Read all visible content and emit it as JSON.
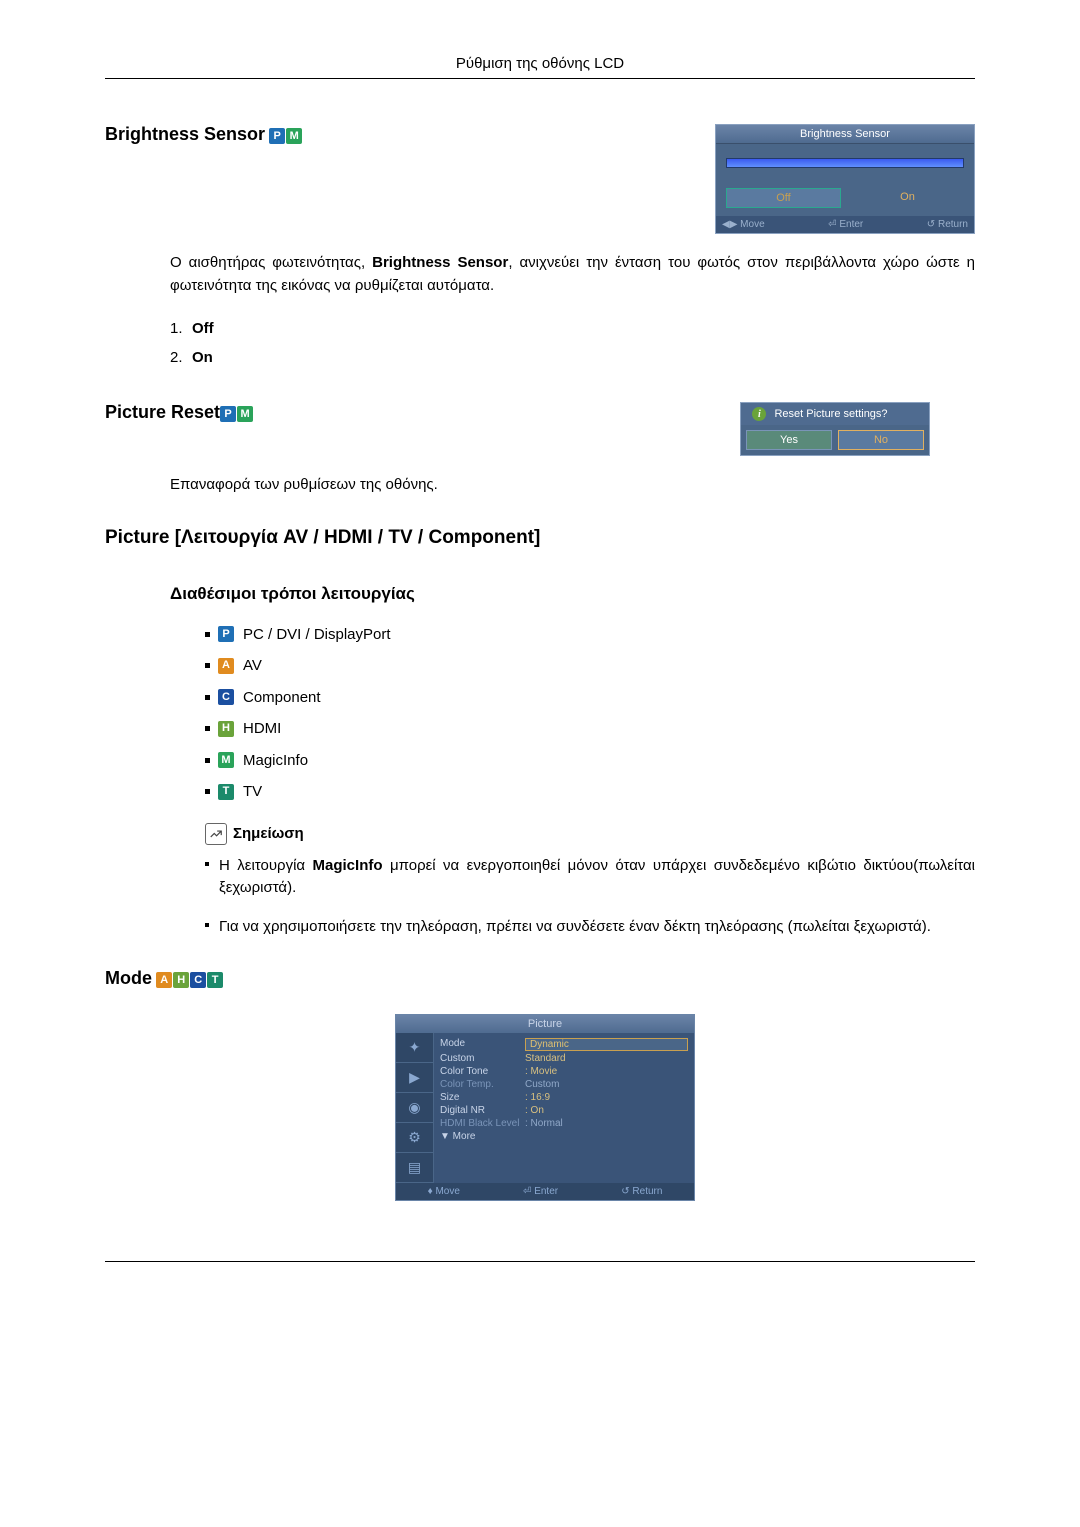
{
  "header": "Ρύθμιση της οθόνης LCD",
  "brightness": {
    "title": "Brightness Sensor",
    "badges": [
      "P",
      "M"
    ],
    "osd_title": "Brightness Sensor",
    "off": "Off",
    "on": "On",
    "footer": {
      "move": "Move",
      "enter": "Enter",
      "ret": "Return"
    },
    "desc_pre": "Ο αισθητήρας φωτεινότητας, ",
    "desc_bold": "Brightness Sensor",
    "desc_post": ", ανιχνεύει την ένταση του φωτός στον περιβάλλοντα χώρο ώστε η φωτεινότητα της εικόνας να ρυθμίζεται αυτόματα.",
    "list": [
      {
        "n": "1.",
        "lbl": "Off"
      },
      {
        "n": "2.",
        "lbl": "On"
      }
    ]
  },
  "reset": {
    "title": "Picture Reset",
    "badges": [
      "P",
      "M"
    ],
    "dlg_q": "Reset Picture settings?",
    "yes": "Yes",
    "no": "No",
    "desc": "Επαναφορά των ρυθμίσεων της οθόνης."
  },
  "picture_section": {
    "title": "Picture [Λειτουργία AV / HDMI / TV / Component]",
    "modes_title": "Διαθέσιμοι τρόποι λειτουργίας",
    "modes": [
      {
        "badge": "P",
        "cls": "bg-p",
        "label": "PC / DVI / DisplayPort"
      },
      {
        "badge": "A",
        "cls": "bg-a",
        "label": "AV"
      },
      {
        "badge": "C",
        "cls": "bg-c",
        "label": "Component"
      },
      {
        "badge": "H",
        "cls": "bg-h",
        "label": "HDMI"
      },
      {
        "badge": "M",
        "cls": "bg-m",
        "label": "MagicInfo"
      },
      {
        "badge": "T",
        "cls": "bg-t",
        "label": "TV"
      }
    ],
    "note_title": "Σημείωση",
    "notes": [
      {
        "pre": "Η λειτουργία ",
        "bold": "MagicInfo",
        "post": " μπορεί να ενεργοποιηθεί μόνον όταν υπάρχει συνδεδεμένο κιβώτιο δικτύου(πωλείται ξεχωριστά)."
      },
      {
        "pre": "",
        "bold": "",
        "post": "Για να χρησιμοποιήσετε την τηλεόραση, πρέπει να συνδέσετε έναν δέκτη τηλεόρασης (πωλείται ξεχωριστά)."
      }
    ]
  },
  "mode": {
    "title": "Mode",
    "badges": [
      {
        "t": "A",
        "cls": "bg-a"
      },
      {
        "t": "H",
        "cls": "bg-h"
      },
      {
        "t": "C",
        "cls": "bg-c"
      },
      {
        "t": "T",
        "cls": "bg-t"
      }
    ],
    "osd_title": "Picture",
    "rows": [
      {
        "label": "Mode",
        "value": "Dynamic",
        "highlight": true,
        "dim": false
      },
      {
        "label": "Custom",
        "value": "Standard",
        "highlight": false,
        "dim": false,
        "val_is_option": true
      },
      {
        "label": "Color Tone",
        "value": "Movie",
        "highlight": false,
        "dim": false,
        "colon": ": ",
        "val_is_option": true
      },
      {
        "label": "Color Temp.",
        "value": "Custom",
        "highlight": false,
        "dim": true,
        "val_is_option": true
      },
      {
        "label": "Size",
        "value": "16:9",
        "highlight": false,
        "dim": false,
        "colon": ": "
      },
      {
        "label": "Digital NR",
        "value": "On",
        "highlight": false,
        "dim": false,
        "colon": ": "
      },
      {
        "label": "HDMI Black Level",
        "value": "Normal",
        "highlight": false,
        "dim": true,
        "colon": ": "
      },
      {
        "label": "▼ More",
        "value": "",
        "highlight": false,
        "dim": false
      }
    ],
    "footer": {
      "move": "Move",
      "enter": "Enter",
      "ret": "Return"
    }
  }
}
